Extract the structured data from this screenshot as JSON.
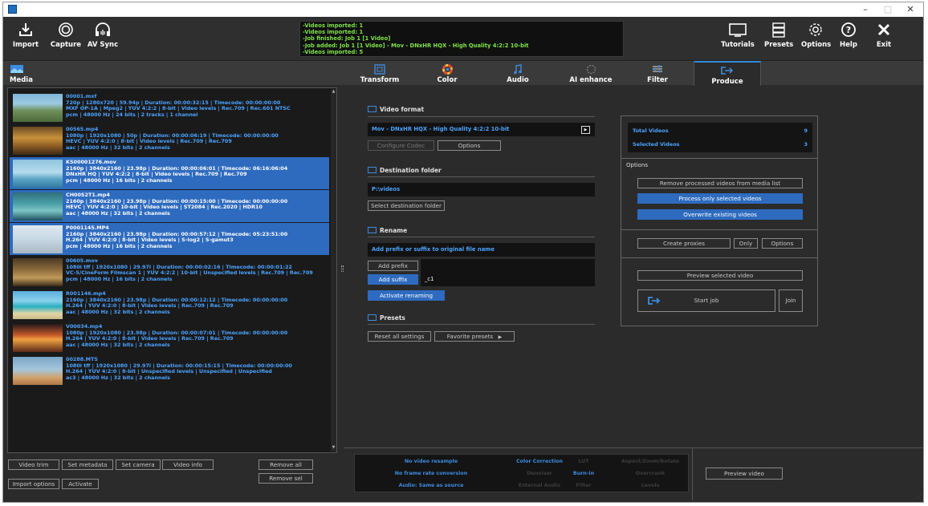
{
  "toolbar": {
    "import": "Import",
    "capture": "Capture",
    "avsync": "AV Sync",
    "tutorials": "Tutorials",
    "presets": "Presets",
    "options": "Options",
    "help": "Help",
    "exit": "Exit"
  },
  "log": [
    "-Videos imported: 1",
    "-Videos imported: 1",
    "-Job finished: Job 1 [1 Video]",
    "-Job added: Job 1 [1 Video] -  Mov - DNxHR HQX - High Quality 4:2:2 10-bit",
    "-Videos imported: 5"
  ],
  "tabs": {
    "media": "Media",
    "transform": "Transform",
    "color": "Color",
    "audio": "Audio",
    "ai_enhance": "AI enhance",
    "filter": "Filter",
    "produce": "Produce"
  },
  "media_items": [
    {
      "name": "00001.mxf",
      "l1": "720p | 1280x720 | 59.94p  | Duration:  00:00:32:15 | Timecode: 00:00:00:00",
      "l2": "MXF OP-1A | Mpeg2 | YUV 4:2:2 | 8-bit | Video levels | Rec.709 | Rec.601 NTSC",
      "l3": "pcm | 48000 Hz | 24 bits | 2 tracks | 1 channel",
      "selected": false
    },
    {
      "name": "00565.mp4",
      "l1": "1080p | 1920x1080 | 50p  | Duration:  00:00:06:19 | Timecode: 00:00:00:00",
      "l2": "HEVC | YUV 4:2:0 | 8-bit | Video levels | Rec.709 | Rec.709",
      "l3": "aac | 48000 Hz | 32 bits | 2 channels",
      "selected": false
    },
    {
      "name": "KS00001276.mov",
      "l1": "2160p | 3840x2160 | 23.98p  | Duration:  00:00:06:01 | Timecode: 06:16:06:04",
      "l2": "DNxHR HQ | YUV 4:2:2 | 8-bit | Video levels | Rec.709 | Rec.709",
      "l3": "pcm | 48000 Hz | 16 bits | 2 channels",
      "selected": true
    },
    {
      "name": "CH00S2T1.mp4",
      "l1": "2160p | 3840x2160 | 23.98p  | Duration:  00:00:15:00 | Timecode: 00:00:00:00",
      "l2": "HEVC | YUV 4:2:0 | 10-bit | Video levels | ST2084 | Rec.2020 | HDR10",
      "l3": "aac | 48000 Hz | 32 bits | 2 channels",
      "selected": true
    },
    {
      "name": "P0001145.MP4",
      "l1": "2160p | 3840x2160 | 23.98p  | Duration:  00:00:57:12 | Timecode: 05:23:51:00",
      "l2": "H.264 | YUV 4:2:0 | 8-bit | Video levels | S-log2 | S-gamut3",
      "l3": "pcm | 48000 Hz | 16 bits | 2 channels",
      "selected": true
    },
    {
      "name": "00605.mov",
      "l1": "1080i tff | 1920x1080 | 29.97i  | Duration:  00:00:02:16 | Timecode: 00:00:01:22",
      "l2": "VC-5/CineForm Filmscan 1 | YUV 4:2:2 | 10-bit | Unspecified levels | Rec.709 | Rec.709",
      "l3": "pcm | 48000 Hz | 16 bits | 2 channels",
      "selected": false
    },
    {
      "name": "R001146.mp4",
      "l1": "2160p | 3840x2160 | 23.98p  | Duration:  00:00:12:12 | Timecode: 00:00:00:00",
      "l2": "H.264 | YUV 4:2:0 | 8-bit | Video levels | Rec.709 | Rec.709",
      "l3": "aac | 48000 Hz | 32 bits | 2 channels",
      "selected": false
    },
    {
      "name": "V00034.mp4",
      "l1": "1080p | 1920x1080 | 23.98p  | Duration:  00:00:07:01 | Timecode: 00:00:00:00",
      "l2": "H.264 | YUV 4:2:0 | 8-bit | Video levels | Rec.709 | Rec.709",
      "l3": "aac | 48000 Hz | 32 bits | 2 channels",
      "selected": false
    },
    {
      "name": "00288.MTS",
      "l1": "1080i tff | 1920x1080 | 29.97i  | Duration:  00:00:15:15 | Timecode: 00:00:00:00",
      "l2": "H.264 | YUV 4:2:0 | 8-bit | Unspecified levels | Unspecified | Unspecified",
      "l3": "ac3 | 48000 Hz | 32 bits | 2 channels",
      "selected": false
    }
  ],
  "media_buttons": {
    "video_trim": "Video trim",
    "set_metadata": "Set metadata",
    "set_camera": "Set camera",
    "video_info": "Video info",
    "remove_all": "Remove all",
    "remove_sel": "Remove sel",
    "import_options": "Import options",
    "activate": "Activate"
  },
  "produce": {
    "video_format_h": "Video format",
    "format_value": "Mov - DNxHR HQX - High Quality 4:2:2 10-bit",
    "configure_codec": "Configure Codec",
    "options": "Options",
    "destination_h": "Destination folder",
    "destination_value": "P:\\videos",
    "select_destination": "Select destination folder",
    "rename_h": "Rename",
    "rename_mode": "Add prefix or suffix to original file name",
    "add_prefix": "Add prefix",
    "prefix_value": "",
    "add_suffix": "Add suffix",
    "suffix_value": "_c1",
    "activate_renaming": "Activate renaming",
    "presets_h": "Presets",
    "reset_all": "Reset all settings",
    "favorite_presets": "Favorite presets"
  },
  "summary": {
    "total_label": "Total Videos",
    "total_value": "9",
    "selected_label": "Selected Videos",
    "selected_value": "3",
    "options_h": "Options",
    "remove_processed": "Remove processed videos from media list",
    "process_selected": "Process only selected videos",
    "overwrite": "Overwrite existing videos",
    "create_proxies": "Create proxies",
    "only": "Only",
    "options": "Options",
    "preview_selected": "Preview selected video",
    "start_job": "Start job",
    "join": "Join"
  },
  "status_strip": {
    "no_resample": "No video resample",
    "no_framerate": "No frame rate conversion",
    "audio_same": "Audio: Same as source",
    "color_correction": "Color Correction",
    "denoiser": "Denoiser",
    "external_audio": "External Audio",
    "lut": "LUT",
    "burn_in": "Burn-in",
    "filter": "Filter",
    "aspect": "Aspect/Zoom/Rotate",
    "overcrank": "Overcrank",
    "levels": "Levels"
  },
  "preview_video": "Preview video",
  "colors": {
    "accent": "#2e6bbf",
    "info_blue": "#4ba3ff",
    "log_green": "#7ee34a",
    "panel_bg": "#2b2b2b"
  }
}
